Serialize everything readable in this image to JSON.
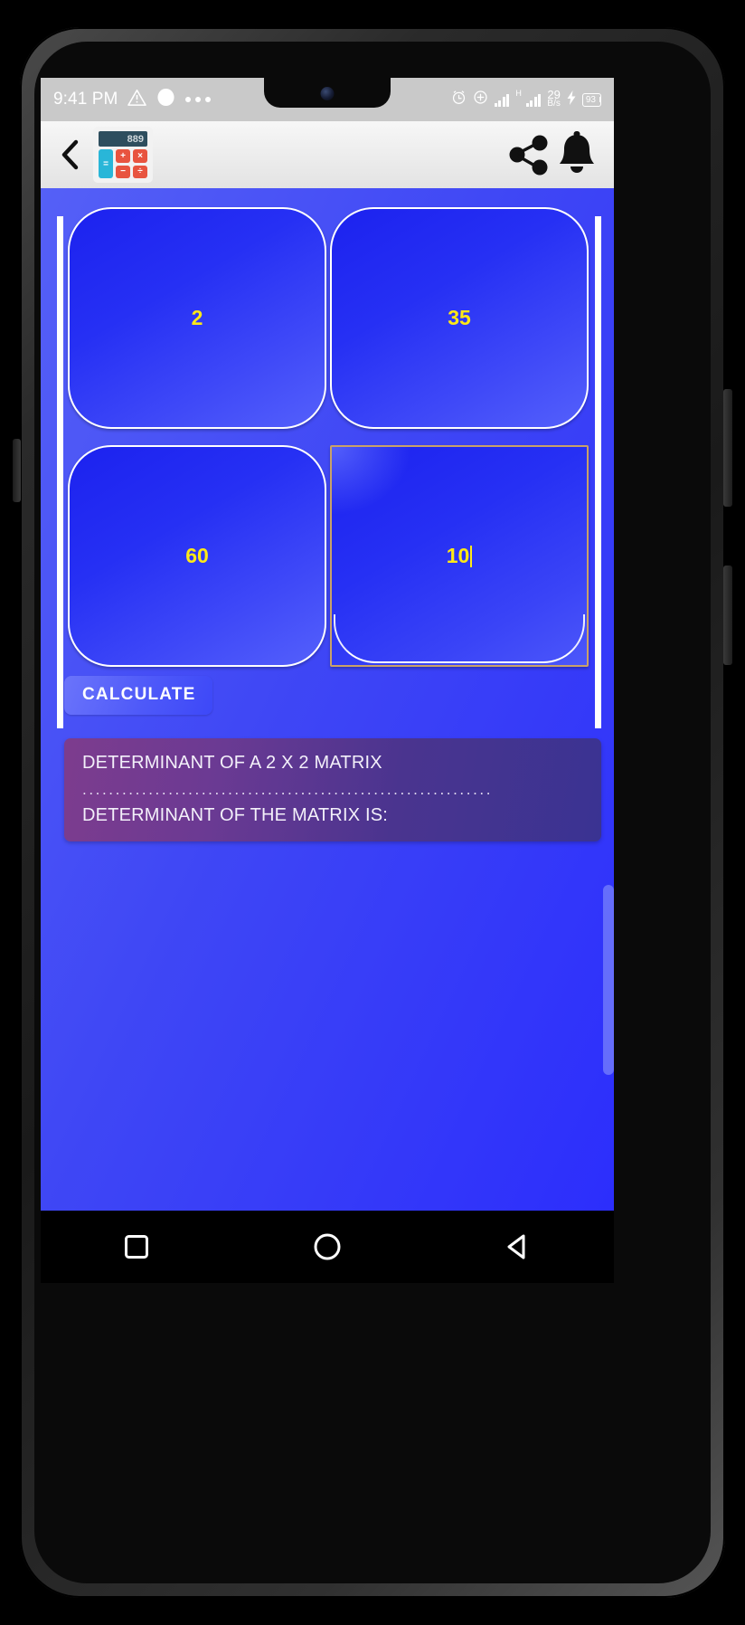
{
  "status_bar": {
    "time": "9:41 PM",
    "warning_icon": "warning-triangle-icon",
    "record_icon": "record-dot-icon",
    "more_icon": "more-dots-icon",
    "alarm_icon": "alarm-clock-icon",
    "dnd_icon": "add-circle-icon",
    "signal_icon": "signal-bars-icon",
    "network_type": "H",
    "net_speed_value": "29",
    "net_speed_unit": "B/s",
    "battery_level": "93",
    "charging_icon": "charging-bolt-icon"
  },
  "app_bar": {
    "back_icon": "chevron-left-icon",
    "app_icon": "calculator-icon",
    "calc_display_value": "889",
    "calc_keys": [
      "+",
      "×",
      "−",
      "÷"
    ],
    "calc_equals_key": "=",
    "share_icon": "share-icon",
    "notification_icon": "bell-icon"
  },
  "matrix": {
    "rows": [
      [
        {
          "label": "cell-a11",
          "value": "2",
          "focused": false
        },
        {
          "label": "cell-a12",
          "value": "35",
          "focused": false
        }
      ],
      [
        {
          "label": "cell-a21",
          "value": "60",
          "focused": false
        },
        {
          "label": "cell-a22",
          "value": "10",
          "focused": true
        }
      ]
    ],
    "value_color": "#ffe916",
    "cell_border_color": "#ffffff",
    "focused_border_color": "#c9a169"
  },
  "actions": {
    "calculate_label": "CALCULATE"
  },
  "result_panel": {
    "title": "DETERMINANT OF A 2 X 2 MATRIX",
    "divider": "..............................................................",
    "result_label": "DETERMINANT OF THE MATRIX IS:",
    "result_value": "",
    "bg_gradient_from": "#7d3c8e",
    "bg_gradient_to": "#3a3392"
  },
  "nav_bar": {
    "recents_icon": "square-recents-icon",
    "home_icon": "circle-home-icon",
    "back_icon": "triangle-back-icon"
  }
}
